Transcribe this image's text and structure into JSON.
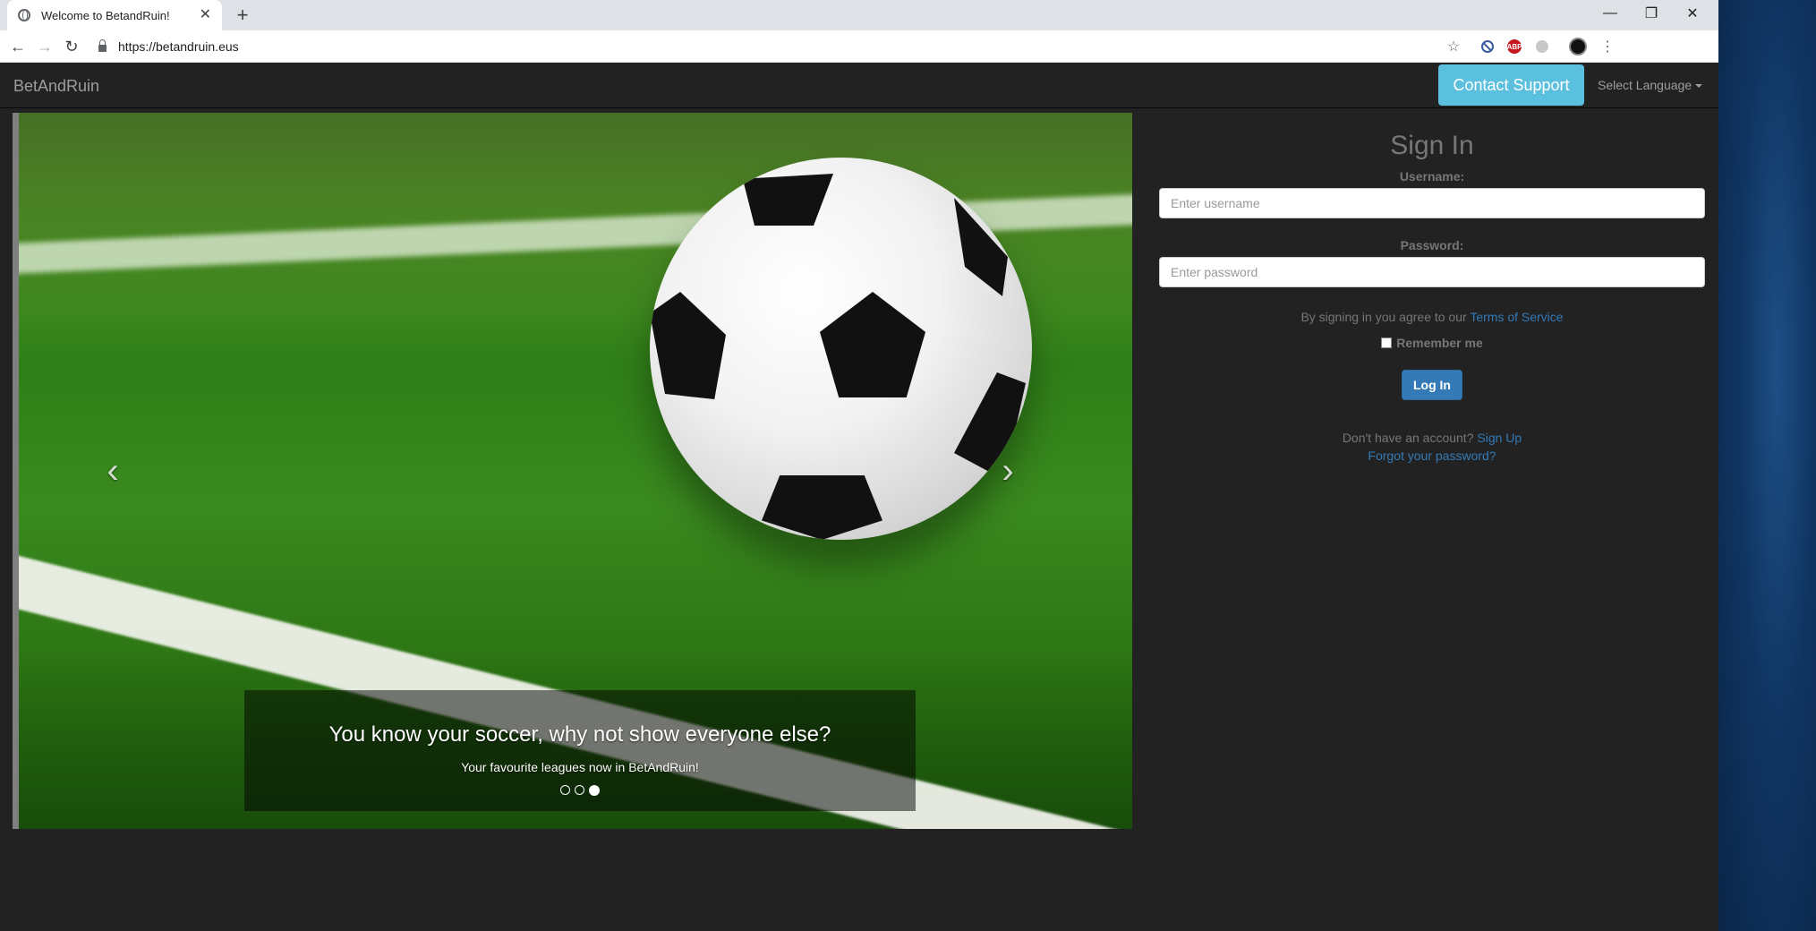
{
  "browser": {
    "tab_title": "Welcome to BetandRuin!",
    "url": "https://betandruin.eus",
    "icons": {
      "tab_close": "close-icon",
      "new_tab": "plus-icon",
      "minimize": "minimize-icon",
      "restore": "restore-icon",
      "close": "close-icon",
      "back": "back-arrow-icon",
      "forward": "forward-arrow-icon",
      "reload": "reload-icon",
      "lock": "lock-icon",
      "bookmark": "star-icon",
      "menu": "kebab-menu-icon"
    },
    "extensions": [
      "block-icon",
      "adblock-plus-icon",
      "gray-extension-icon",
      "profile-avatar-icon"
    ],
    "abp_label": "ABP"
  },
  "navbar": {
    "brand": "BetAndRuin",
    "contact_support": "Contact Support",
    "select_language": "Select Language"
  },
  "carousel": {
    "caption_title": "You know your soccer, why not show everyone else?",
    "caption_subtitle": "Your favourite leagues now in BetAndRuin!",
    "slide_count": 3,
    "active_slide": 3,
    "prev_icon": "chevron-left-icon",
    "next_icon": "chevron-right-icon"
  },
  "signin": {
    "title": "Sign In",
    "username_label": "Username:",
    "username_placeholder": "Enter username",
    "password_label": "Password:",
    "password_placeholder": "Enter password",
    "terms_prefix": "By signing in you agree to our",
    "terms_link": "Terms of Service",
    "remember_me": "Remember me",
    "remember_checked": false,
    "login_button": "Log In",
    "no_account": "Don't have an account?",
    "sign_up": "Sign Up",
    "forgot_password": "Forgot your password?"
  },
  "colors": {
    "page_bg": "#222222",
    "contact_button": "#5bc0de",
    "primary_button": "#337ab7",
    "link": "#337ab7",
    "muted_text": "#777777"
  }
}
